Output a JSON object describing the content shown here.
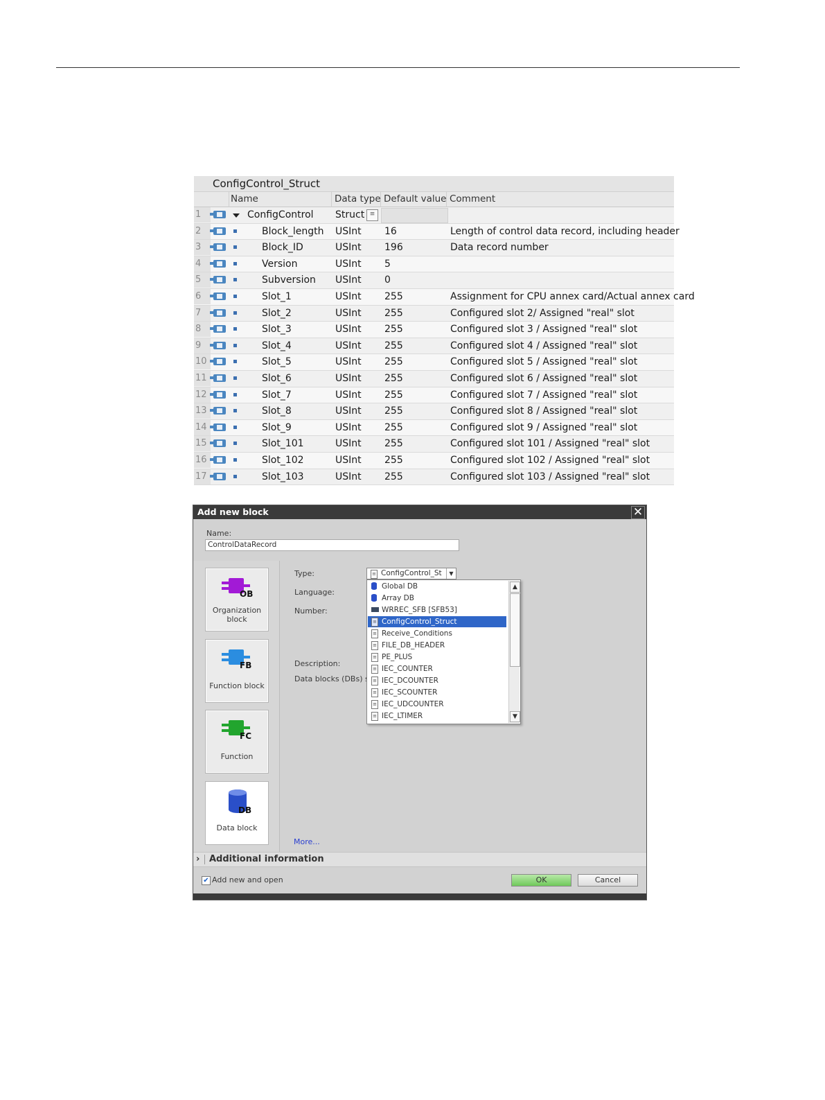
{
  "struct_table": {
    "title": "ConfigControl_Struct",
    "columns": [
      "Name",
      "Data type",
      "Default value",
      "Comment"
    ],
    "rows": [
      {
        "num": "1",
        "name": "ConfigControl",
        "type": "Struct",
        "default": "",
        "comment": ""
      },
      {
        "num": "2",
        "name": "Block_length",
        "type": "USInt",
        "default": "16",
        "comment": "Length of control data record, including header"
      },
      {
        "num": "3",
        "name": "Block_ID",
        "type": "USInt",
        "default": "196",
        "comment": "Data record number"
      },
      {
        "num": "4",
        "name": "Version",
        "type": "USInt",
        "default": "5",
        "comment": ""
      },
      {
        "num": "5",
        "name": "Subversion",
        "type": "USInt",
        "default": "0",
        "comment": ""
      },
      {
        "num": "6",
        "name": "Slot_1",
        "type": "USInt",
        "default": "255",
        "comment": "Assignment for CPU annex card/Actual annex card"
      },
      {
        "num": "7",
        "name": "Slot_2",
        "type": "USInt",
        "default": "255",
        "comment": "Configured slot 2/ Assigned \"real\" slot"
      },
      {
        "num": "8",
        "name": "Slot_3",
        "type": "USInt",
        "default": "255",
        "comment": "Configured slot 3 / Assigned \"real\" slot"
      },
      {
        "num": "9",
        "name": "Slot_4",
        "type": "USInt",
        "default": "255",
        "comment": "Configured slot 4 / Assigned \"real\" slot"
      },
      {
        "num": "10",
        "name": "Slot_5",
        "type": "USInt",
        "default": "255",
        "comment": "Configured slot 5 / Assigned \"real\" slot"
      },
      {
        "num": "11",
        "name": "Slot_6",
        "type": "USInt",
        "default": "255",
        "comment": "Configured slot 6 / Assigned \"real\" slot"
      },
      {
        "num": "12",
        "name": "Slot_7",
        "type": "USInt",
        "default": "255",
        "comment": "Configured slot 7 / Assigned \"real\" slot"
      },
      {
        "num": "13",
        "name": "Slot_8",
        "type": "USInt",
        "default": "255",
        "comment": "Configured slot 8 / Assigned \"real\" slot"
      },
      {
        "num": "14",
        "name": "Slot_9",
        "type": "USInt",
        "default": "255",
        "comment": "Configured slot 9 / Assigned \"real\" slot"
      },
      {
        "num": "15",
        "name": "Slot_101",
        "type": "USInt",
        "default": "255",
        "comment": "Configured slot 101 / Assigned \"real\" slot"
      },
      {
        "num": "16",
        "name": "Slot_102",
        "type": "USInt",
        "default": "255",
        "comment": "Configured slot 102 / Assigned \"real\" slot"
      },
      {
        "num": "17",
        "name": "Slot_103",
        "type": "USInt",
        "default": "255",
        "comment": "Configured slot 103 / Assigned \"real\" slot"
      }
    ]
  },
  "dialog": {
    "title": "Add new block",
    "name_label": "Name:",
    "name_value": "ControlDataRecord",
    "blocks": [
      {
        "label": "Organization block",
        "letters": "OB",
        "color": "#a21ad6",
        "icon": "ob-block-icon"
      },
      {
        "label": "Function block",
        "letters": "FB",
        "color": "#2b8de0",
        "icon": "fb-block-icon"
      },
      {
        "label": "Function",
        "letters": "FC",
        "color": "#22a52e",
        "icon": "fc-block-icon"
      },
      {
        "label": "Data block",
        "letters": "DB",
        "color": "#2a4fc8",
        "icon": "db-cylinder-icon"
      }
    ],
    "type_label": "Type:",
    "type_value": "ConfigControl_Stru",
    "language_label": "Language:",
    "number_label": "Number:",
    "description_label": "Description:",
    "description_text": "Data blocks (DBs) sa",
    "dropdown_items": [
      {
        "label": "Global DB",
        "icon": "db-icon"
      },
      {
        "label": "Array DB",
        "icon": "db-icon"
      },
      {
        "label": "WRREC_SFB  [SFB53]",
        "icon": "fb-icon"
      },
      {
        "label": "ConfigControl_Struct",
        "icon": "struct-icon",
        "selected": true
      },
      {
        "label": "Receive_Conditions",
        "icon": "struct-icon"
      },
      {
        "label": "FILE_DB_HEADER",
        "icon": "struct-icon"
      },
      {
        "label": "PE_PLUS",
        "icon": "struct-icon"
      },
      {
        "label": "IEC_COUNTER",
        "icon": "struct-icon"
      },
      {
        "label": "IEC_DCOUNTER",
        "icon": "struct-icon"
      },
      {
        "label": "IEC_SCOUNTER",
        "icon": "struct-icon"
      },
      {
        "label": "IEC_UDCOUNTER",
        "icon": "struct-icon"
      },
      {
        "label": "IEC_LTIMER",
        "icon": "struct-icon"
      }
    ],
    "more_link": "More...",
    "additional_info": "Additional  information",
    "add_new_and_open": "Add new and open",
    "add_new_and_open_checked": true,
    "ok_label": "OK",
    "cancel_label": "Cancel"
  }
}
